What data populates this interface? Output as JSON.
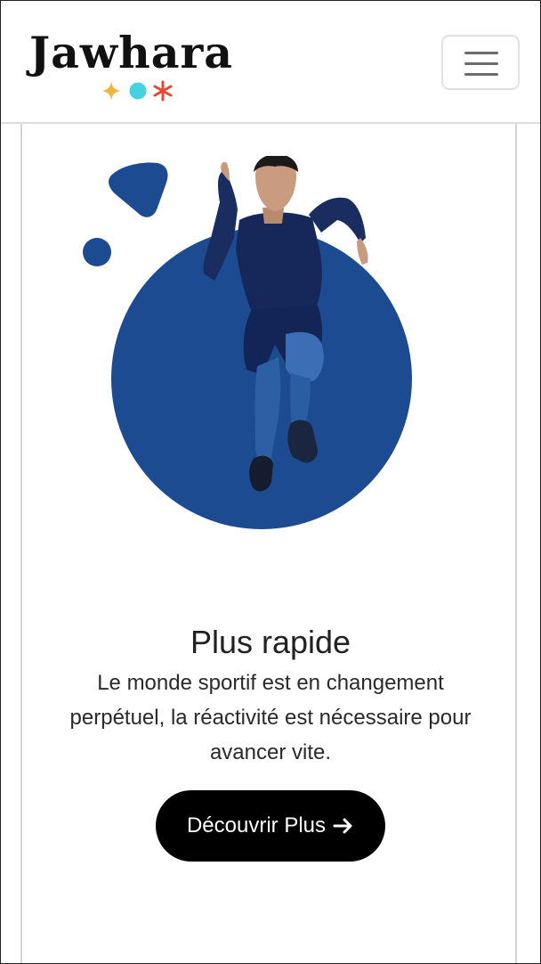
{
  "header": {
    "brand_name": "Jawhara",
    "brand_mark_icons": [
      "sparkle-icon",
      "dot-icon",
      "asterisk-icon"
    ],
    "brand_mark_colors": [
      "#f2b441",
      "#45d3e3",
      "#e5482e"
    ],
    "menu_icon": "hamburger-icon"
  },
  "hero": {
    "image": "sprinter-athlete-illustration",
    "accent_color": "#1d4b91"
  },
  "content": {
    "title": "Plus rapide",
    "description": "Le monde sportif est en changement perpétuel, la réactivité est nécessaire pour avancer vite.",
    "cta_label": "Découvrir Plus",
    "cta_icon": "arrow-right-icon"
  }
}
